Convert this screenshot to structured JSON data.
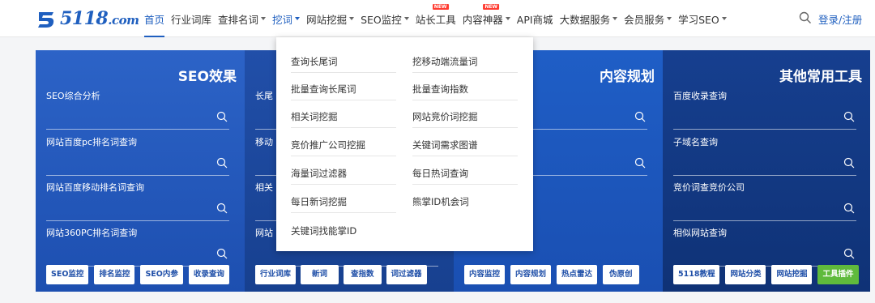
{
  "brand": {
    "logo_number": "5118",
    "logo_suffix": ".com"
  },
  "nav": {
    "items": [
      {
        "label": "首页"
      },
      {
        "label": "行业词库"
      },
      {
        "label": "查排名词"
      },
      {
        "label": "挖词"
      },
      {
        "label": "网站挖掘"
      },
      {
        "label": "SEO监控"
      },
      {
        "label": "站长工具",
        "badge": "NEW"
      },
      {
        "label": "内容神器",
        "badge": "NEW"
      },
      {
        "label": "API商城"
      },
      {
        "label": "大数据服务"
      },
      {
        "label": "会员服务"
      },
      {
        "label": "学习SEO"
      }
    ],
    "login": "登录/注册"
  },
  "dropdown": {
    "left": [
      "查询长尾词",
      "批量查询长尾词",
      "相关词挖掘",
      "竞价推广公司挖掘",
      "海量词过滤器",
      "每日新词挖掘",
      "关键词找能掌ID"
    ],
    "right": [
      "挖移动端流量词",
      "批量查询指数",
      "网站竞价词挖掘",
      "关键词需求图谱",
      "每日热词查询",
      "熊掌ID机会词"
    ]
  },
  "panels": [
    {
      "title": "SEO效果",
      "tools": [
        "SEO综合分析",
        "网站百度pc排名词查询",
        "网站百度移动排名词查询",
        "网站360PC排名词查询"
      ],
      "buttons": [
        "SEO监控",
        "排名监控",
        "SEO内参",
        "收录查询"
      ]
    },
    {
      "title": "",
      "tools": [
        "长尾",
        "移动",
        "相关",
        "网站"
      ],
      "buttons": [
        "行业词库",
        "新词",
        "查指数",
        "词过滤器"
      ]
    },
    {
      "title": "内容规划",
      "tools": [
        "",
        "",
        "",
        ""
      ],
      "buttons": [
        "内容监控",
        "内容规划",
        "热点雷达",
        "伪原创"
      ]
    },
    {
      "title": "其他常用工具",
      "tools": [
        "百度收录查询",
        "子域名查询",
        "竞价词查竞价公司",
        "相似网站查询"
      ],
      "buttons": [
        "5118教程",
        "网站分类",
        "网站挖掘",
        "工具插件"
      ]
    }
  ],
  "colors": {
    "accent": "#1f5fbf",
    "green_button": "#5fba3c",
    "badge_red": "#ff3b30"
  }
}
